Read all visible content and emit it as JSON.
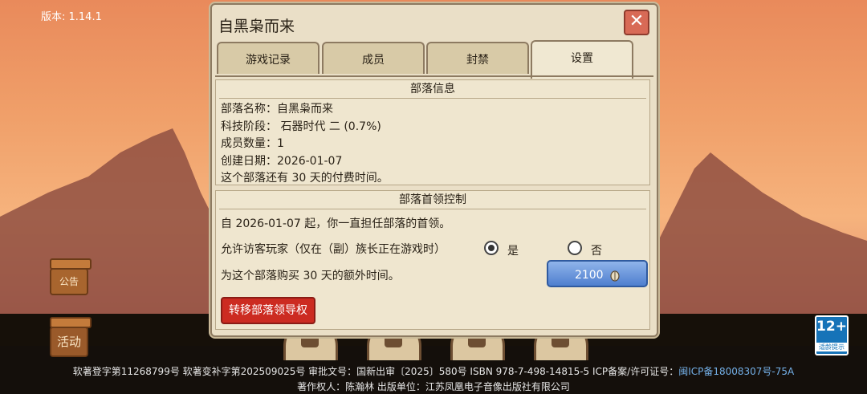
{
  "version_label": "版本: 1.14.1",
  "side_buttons": {
    "notice_label": "公告",
    "activity_label": "活动"
  },
  "age_badge": {
    "rating": "12+",
    "caption": "适龄提示"
  },
  "footer": {
    "line1_text": "软著登字第11268799号 软著变补字第202509025号 审批文号：国新出审〔2025〕580号 ISBN 978-7-498-14815-5 ICP备案/许可证号：",
    "line1_icp": "闽ICP备18008307号-75A",
    "line2": "著作权人：陈瀚林 出版单位：江苏凤凰电子音像出版社有限公司"
  },
  "dialog": {
    "title": "自黑枭而来",
    "close_glyph": "✕",
    "tabs": [
      {
        "label": "游戏记录",
        "active": false
      },
      {
        "label": "成员",
        "active": false
      },
      {
        "label": "封禁",
        "active": false
      },
      {
        "label": "设置",
        "active": true
      }
    ],
    "tribe_info": {
      "heading": "部落信息",
      "lines": [
        "部落名称：自黑枭而来",
        "科技阶段： 石器时代 二 (0.7%)",
        "成员数量：1",
        "创建日期：2026-01-07",
        "这个部落还有 30 天的付费时间。"
      ]
    },
    "leader_control": {
      "heading": "部落首领控制",
      "since_text": "自 2026-01-07 起，你一直担任部落的首领。",
      "allow_guest_text": "允许访客玩家（仅在（副）族长正在游戏时）",
      "radio_yes": "是",
      "radio_no": "否",
      "radio_selected": "yes",
      "buy_time_text": "为这个部落购买 30 天的额外时间。",
      "buy_price": "2100",
      "transfer_button": "转移部落领导权"
    }
  }
}
